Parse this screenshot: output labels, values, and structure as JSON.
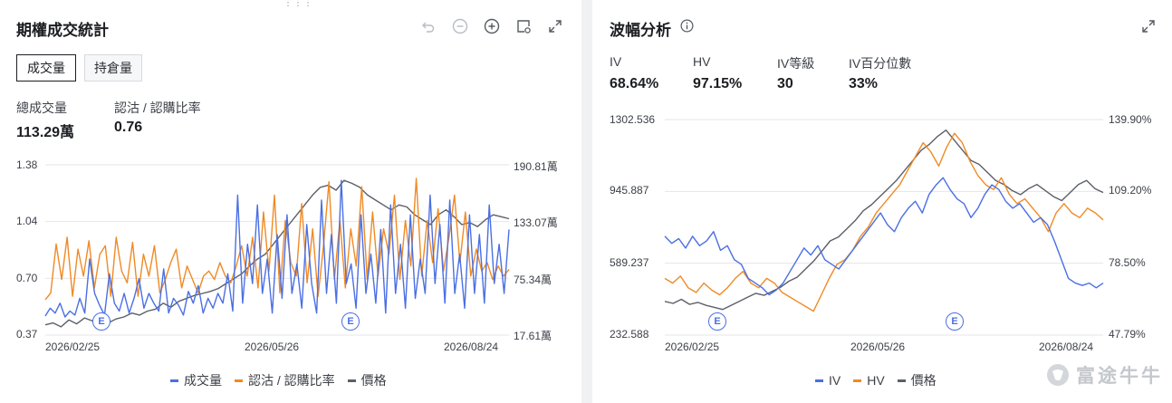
{
  "left": {
    "title": "期權成交統計",
    "tabs": [
      {
        "label": "成交量",
        "active": true
      },
      {
        "label": "持倉量",
        "active": false
      }
    ],
    "stats": [
      {
        "label": "總成交量",
        "value": "113.29萬"
      },
      {
        "label": "認沽 / 認購比率",
        "value": "0.76"
      }
    ],
    "y_left_ticks": [
      "1.38",
      "1.04",
      "0.70",
      "0.37"
    ],
    "y_right_ticks": [
      "190.81萬",
      "133.07萬",
      "75.34萬",
      "17.61萬"
    ],
    "x_ticks": [
      "2026/02/25",
      "2026/05/26",
      "2026/08/24"
    ],
    "event_markers": [
      "E",
      "E"
    ],
    "legend": [
      "成交量",
      "認沽 / 認購比率",
      "價格"
    ],
    "icons": [
      "undo-icon",
      "zoom-out-icon",
      "zoom-in-icon",
      "chart-settings-icon",
      "expand-icon"
    ]
  },
  "right": {
    "title": "波幅分析",
    "stats": [
      {
        "label": "IV",
        "value": "68.64%"
      },
      {
        "label": "HV",
        "value": "97.15%"
      },
      {
        "label": "IV等級",
        "value": "30"
      },
      {
        "label": "IV百分位數",
        "value": "33%"
      }
    ],
    "y_left_ticks": [
      "1302.536",
      "945.887",
      "589.237",
      "232.588"
    ],
    "y_right_ticks": [
      "139.90%",
      "109.20%",
      "78.50%",
      "47.79%"
    ],
    "x_ticks": [
      "2026/02/25",
      "2026/05/26",
      "2026/08/24"
    ],
    "event_markers": [
      "E",
      "E"
    ],
    "legend": [
      "IV",
      "HV",
      "價格"
    ],
    "icons": [
      "info-icon",
      "expand-icon"
    ]
  },
  "watermark": "富途牛牛",
  "colors": {
    "blue": "#4a6fe3",
    "orange": "#f08a24",
    "gray": "#5b5f68",
    "grid": "#e4e6ea"
  },
  "chart_data": [
    {
      "type": "line",
      "title": "期權成交統計",
      "x_ticks": [
        "2026/02/25",
        "2026/05/26",
        "2026/08/24"
      ],
      "y_left_range": [
        0.37,
        1.38
      ],
      "y_right_range": [
        "17.61萬",
        "190.81萬"
      ],
      "series": [
        {
          "name": "成交量",
          "axis": "right",
          "unit": "萬",
          "values": [
            37,
            45,
            40,
            50,
            36,
            42,
            38,
            55,
            40,
            95,
            60,
            48,
            38,
            80,
            50,
            42,
            60,
            40,
            55,
            75,
            45,
            60,
            50,
            42,
            85,
            40,
            55,
            48,
            38,
            62,
            50,
            68,
            40,
            55,
            45,
            60,
            50,
            80,
            42,
            160,
            50,
            110,
            70,
            150,
            60,
            95,
            40,
            120,
            55,
            140,
            60,
            90,
            45,
            130,
            70,
            40,
            155,
            60,
            120,
            50,
            175,
            70,
            90,
            45,
            140,
            60,
            100,
            50,
            125,
            40,
            150,
            60,
            110,
            45,
            140,
            55,
            95,
            60,
            160,
            70,
            130,
            50,
            155,
            60,
            100,
            45,
            140,
            60,
            120,
            50,
            150,
            70,
            110,
            60,
            125
          ]
        },
        {
          "name": "認沽 / 認購比率",
          "axis": "left",
          "values": [
            0.58,
            0.62,
            0.91,
            0.7,
            0.95,
            0.6,
            0.88,
            0.72,
            0.93,
            0.65,
            0.85,
            0.9,
            0.6,
            0.95,
            0.75,
            0.68,
            0.92,
            0.6,
            0.85,
            0.72,
            0.9,
            0.62,
            0.7,
            0.8,
            0.88,
            0.65,
            0.78,
            0.7,
            0.62,
            0.72,
            0.75,
            0.7,
            0.8,
            0.72,
            0.68,
            0.78,
            0.9,
            0.72,
            0.95,
            0.65,
            1.1,
            0.75,
            1.2,
            0.62,
            1.05,
            0.8,
            0.72,
            1.15,
            0.68,
            1.0,
            0.6,
            0.9,
            1.28,
            0.7,
            1.05,
            0.65,
            1.0,
            0.78,
            1.25,
            0.7,
            1.1,
            0.72,
            1.0,
            0.85,
            1.2,
            0.7,
            1.05,
            0.78,
            1.3,
            0.72,
            1.05,
            0.8,
            1.12,
            0.75,
            0.95,
            1.2,
            0.8,
            1.1,
            0.72,
            0.88,
            0.75,
            0.8,
            0.7,
            0.78,
            0.72,
            0.76
          ]
        },
        {
          "name": "價格",
          "axis": "right",
          "unit": "萬",
          "values": [
            28,
            30,
            26,
            33,
            29,
            35,
            32,
            38,
            30,
            34,
            36,
            40,
            38,
            42,
            44,
            50,
            46,
            52,
            55,
            58,
            60,
            62,
            65,
            70,
            75,
            80,
            88,
            95,
            100,
            110,
            120,
            130,
            140,
            150,
            160,
            168,
            170,
            165,
            175,
            172,
            168,
            160,
            155,
            150,
            145,
            150,
            148,
            140,
            135,
            130,
            140,
            145,
            138,
            130,
            132,
            128,
            135,
            140,
            138,
            136
          ]
        }
      ]
    },
    {
      "type": "line",
      "title": "波幅分析",
      "x_ticks": [
        "2026/02/25",
        "2026/05/26",
        "2026/08/24"
      ],
      "y_left_range": [
        232.588,
        1302.536
      ],
      "y_right_range": [
        47.79,
        139.9
      ],
      "series": [
        {
          "name": "IV",
          "axis": "right",
          "unit": "%",
          "values": [
            90,
            87,
            89,
            85,
            90,
            86,
            88,
            92,
            84,
            86,
            80,
            78,
            72,
            70,
            68,
            65,
            67,
            70,
            75,
            80,
            85,
            82,
            86,
            80,
            78,
            76,
            80,
            84,
            88,
            92,
            96,
            100,
            95,
            92,
            98,
            102,
            105,
            100,
            108,
            112,
            115,
            110,
            106,
            104,
            98,
            102,
            108,
            112,
            110,
            105,
            102,
            104,
            100,
            96,
            98,
            95,
            88,
            80,
            72,
            70,
            69,
            70,
            68,
            70
          ]
        },
        {
          "name": "HV",
          "axis": "right",
          "unit": "%",
          "values": [
            72,
            70,
            73,
            68,
            66,
            70,
            67,
            65,
            68,
            72,
            75,
            70,
            68,
            72,
            70,
            66,
            64,
            62,
            60,
            58,
            65,
            72,
            78,
            80,
            84,
            90,
            94,
            100,
            104,
            108,
            112,
            118,
            124,
            130,
            126,
            120,
            128,
            134,
            130,
            122,
            116,
            112,
            110,
            115,
            108,
            104,
            106,
            102,
            98,
            92,
            100,
            104,
            100,
            98,
            102,
            100,
            97
          ]
        },
        {
          "name": "價格",
          "axis": "left",
          "values": [
            400,
            390,
            410,
            385,
            395,
            380,
            370,
            360,
            380,
            400,
            420,
            440,
            430,
            450,
            470,
            500,
            520,
            560,
            600,
            650,
            700,
            720,
            760,
            800,
            850,
            880,
            920,
            960,
            1000,
            1050,
            1100,
            1150,
            1180,
            1220,
            1250,
            1200,
            1150,
            1100,
            1080,
            1040,
            1000,
            980,
            950,
            930,
            960,
            980,
            950,
            920,
            900,
            940,
            980,
            1000,
            960,
            940
          ]
        }
      ]
    }
  ]
}
